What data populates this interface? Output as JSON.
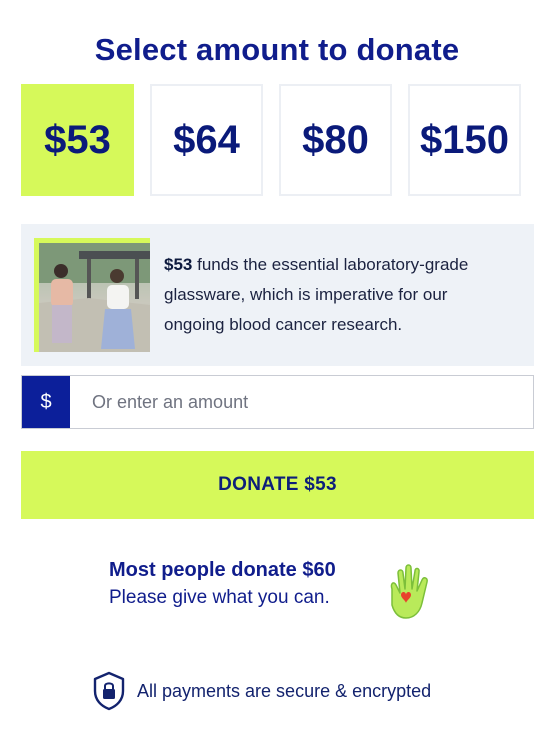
{
  "title": "Select amount to donate",
  "amounts": [
    {
      "label": "$53",
      "selected": true
    },
    {
      "label": "$64",
      "selected": false
    },
    {
      "label": "$80",
      "selected": false
    },
    {
      "label": "$150",
      "selected": false
    }
  ],
  "info": {
    "amount": "$53",
    "text": " funds the essential laboratory-grade glassware, which is imperative for our ongoing blood cancer research."
  },
  "custom_amount": {
    "currency_symbol": "$",
    "placeholder": "Or enter an amount",
    "value": ""
  },
  "donate_button": "DONATE $53",
  "most_people": {
    "line1": "Most people donate $60",
    "line2": "Please give what you can."
  },
  "secure_text": "All payments are secure & encrypted",
  "icons": {
    "hand": "hand-heart-icon",
    "lock": "shield-lock-icon"
  },
  "colors": {
    "accent": "#d6f95a",
    "navy": "#101d8c",
    "currency_bg": "#0c1f9a",
    "info_bg": "#eef2f7"
  }
}
